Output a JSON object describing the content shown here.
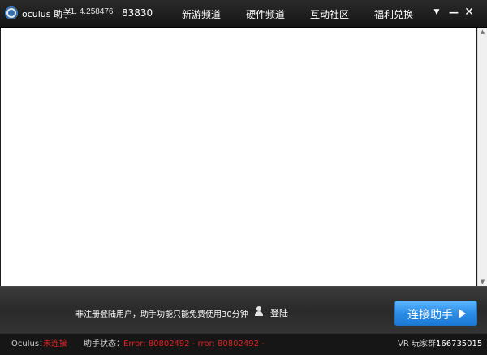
{
  "titlebar": {
    "app_name": "oculus 助手",
    "version": "V1. 4.258476",
    "count": "83830",
    "nav": [
      "新游频道",
      "硬件频道",
      "互动社区",
      "福利兑换"
    ],
    "dropdown_glyph": "▼",
    "minimize_glyph": "—",
    "close_glyph": "✕"
  },
  "scrollbar": {
    "up_glyph": "▲",
    "down_glyph": "▼"
  },
  "bottom": {
    "notice": "非注册登陆用户，助手功能只能免费使用30分钟",
    "login_label": "登陆",
    "connect_label": "连接助手"
  },
  "status": {
    "oculus_label": "Oculus：",
    "oculus_value": "未连接",
    "assistant_label": "助手状态：",
    "assistant_value": "Error: 80802492 - rror: 80802492 -",
    "vr_group_label": "VR 玩家群：",
    "vr_group_value": "166735015"
  },
  "colors": {
    "accent_blue": "#2b8de6",
    "error_red": "#e02020",
    "titlebar_bg": "#1d1d1d"
  },
  "icons": {
    "logo": "oculus-logo-icon",
    "user": "user-icon",
    "connect_arrow": "play-arrow-icon"
  }
}
